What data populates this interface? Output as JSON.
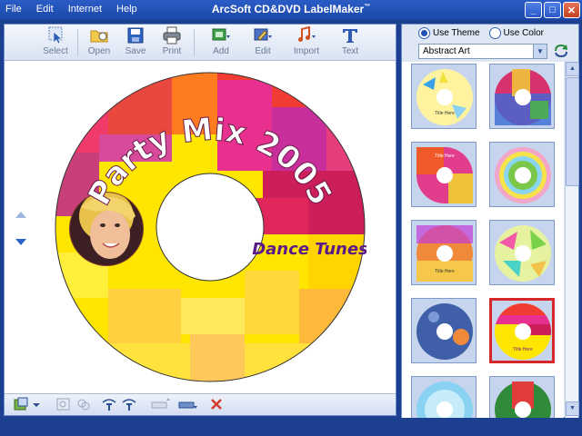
{
  "titlebar": {
    "menu": [
      "File",
      "Edit",
      "Internet",
      "Help"
    ],
    "title": "ArcSoft CD&DVD LabelMaker",
    "title_mark": "™"
  },
  "toolbar": {
    "select": "Select",
    "open": "Open",
    "save": "Save",
    "print": "Print",
    "add": "Add",
    "edit": "Edit",
    "import": "Import",
    "text": "Text"
  },
  "disc": {
    "title_text": "Party Mix 2005",
    "subtitle_text": "Dance Tunes"
  },
  "theme_panel": {
    "use_theme": "Use Theme",
    "use_color": "Use Color",
    "use_theme_selected": true,
    "theme_value": "Abstract Art"
  },
  "thumbnails": [
    {
      "text": "Title Here"
    },
    {
      "text": ""
    },
    {
      "text": "Title Here"
    },
    {
      "text": ""
    },
    {
      "text": "Title Here"
    },
    {
      "text": ""
    },
    {
      "text": ""
    },
    {
      "text": "Title Here"
    },
    {
      "text": ""
    },
    {
      "text": ""
    }
  ],
  "colors": {
    "accent": "#2b5cc6",
    "selected_border": "#d62828"
  }
}
